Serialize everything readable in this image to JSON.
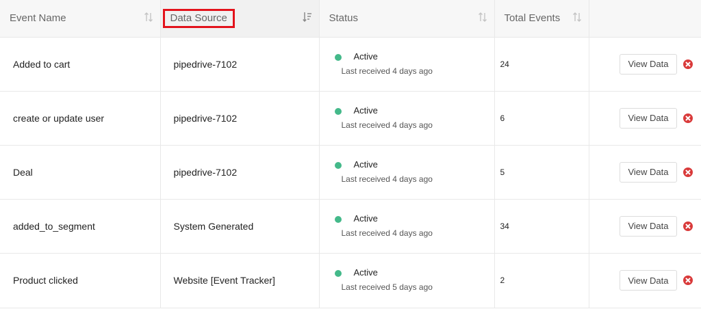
{
  "headers": {
    "event_name": "Event Name",
    "data_source": "Data Source",
    "status": "Status",
    "total_events": "Total Events"
  },
  "colors": {
    "status_active": "#44b98a",
    "delete": "#d93a3a",
    "highlight": "#e3121b"
  },
  "rows": [
    {
      "event_name": "Added to cart",
      "data_source": "pipedrive-7102",
      "status": "Active",
      "last_received": "Last received 4 days ago",
      "total_events": "24",
      "view_label": "View Data"
    },
    {
      "event_name": "create or update user",
      "data_source": "pipedrive-7102",
      "status": "Active",
      "last_received": "Last received 4 days ago",
      "total_events": "6",
      "view_label": "View Data"
    },
    {
      "event_name": "Deal",
      "data_source": "pipedrive-7102",
      "status": "Active",
      "last_received": "Last received 4 days ago",
      "total_events": "5",
      "view_label": "View Data"
    },
    {
      "event_name": "added_to_segment",
      "data_source": "System Generated",
      "status": "Active",
      "last_received": "Last received 4 days ago",
      "total_events": "34",
      "view_label": "View Data"
    },
    {
      "event_name": "Product clicked",
      "data_source": "Website [Event Tracker]",
      "status": "Active",
      "last_received": "Last received 5 days ago",
      "total_events": "2",
      "view_label": "View Data"
    }
  ]
}
